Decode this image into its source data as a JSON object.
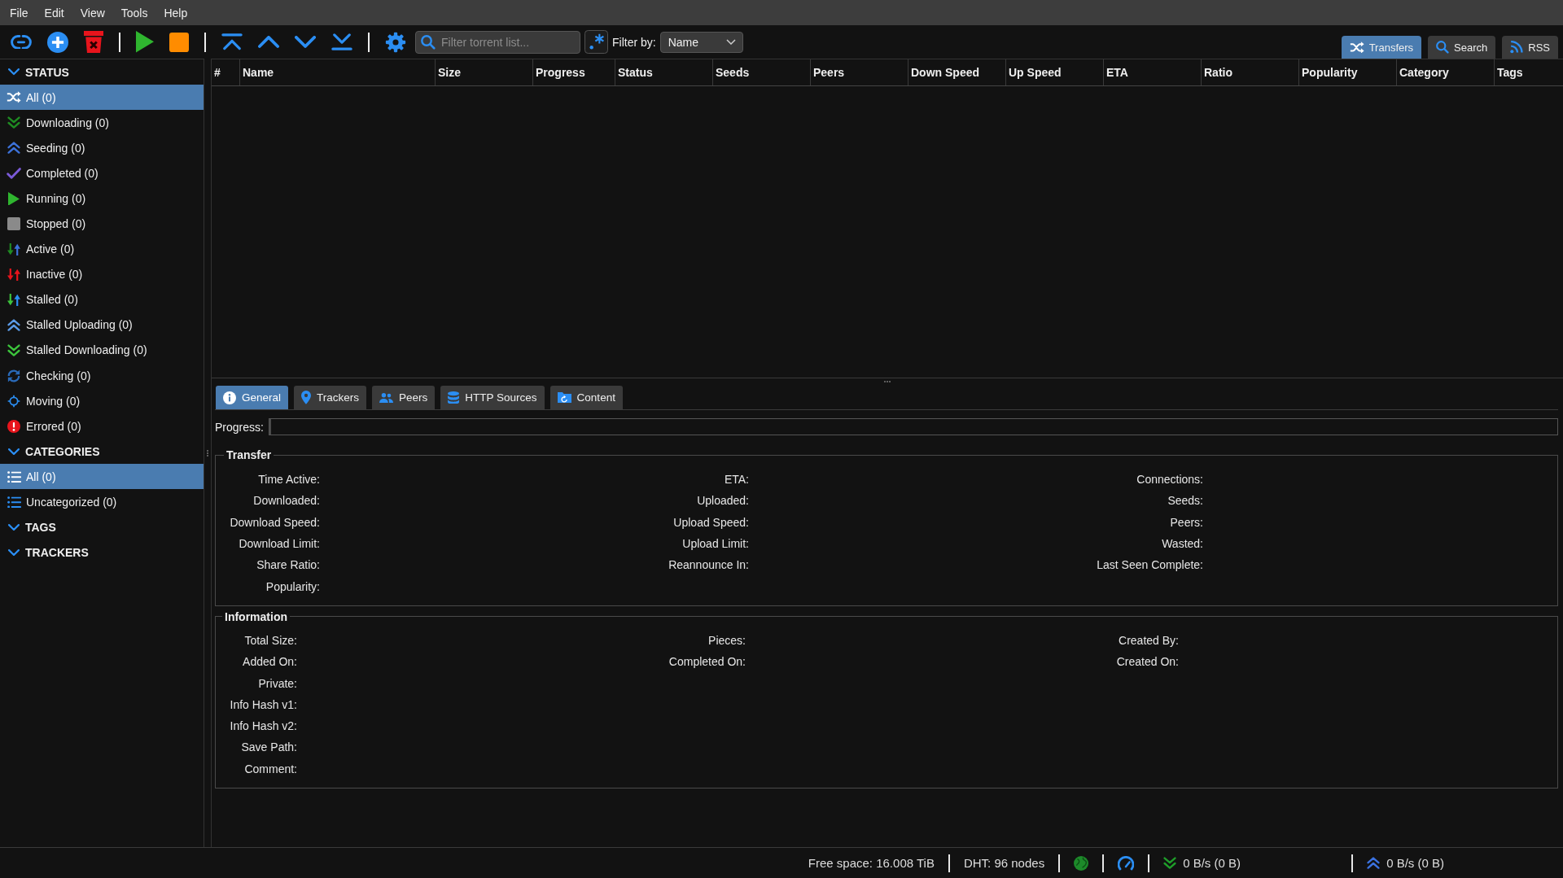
{
  "menu_bar": [
    "File",
    "Edit",
    "View",
    "Tools",
    "Help"
  ],
  "toolbar": {
    "filter": {
      "placeholder": "Filter torrent list..."
    },
    "filter_by": {
      "label": "Filter by:",
      "value": "Name"
    }
  },
  "view_tabs": [
    {
      "label": "Transfers",
      "selected": true
    },
    {
      "label": "Search",
      "selected": false
    },
    {
      "label": "RSS",
      "selected": false
    }
  ],
  "sidebar": {
    "sections": [
      {
        "title": "STATUS",
        "expanded": true,
        "items": [
          {
            "label": "All (0)",
            "selected": true
          },
          {
            "label": "Downloading (0)",
            "selected": false
          },
          {
            "label": "Seeding (0)",
            "selected": false
          },
          {
            "label": "Completed (0)",
            "selected": false
          },
          {
            "label": "Running (0)",
            "selected": false
          },
          {
            "label": "Stopped (0)",
            "selected": false
          },
          {
            "label": "Active (0)",
            "selected": false
          },
          {
            "label": "Inactive (0)",
            "selected": false
          },
          {
            "label": "Stalled (0)",
            "selected": false
          },
          {
            "label": "Stalled Uploading (0)",
            "selected": false
          },
          {
            "label": "Stalled Downloading (0)",
            "selected": false
          },
          {
            "label": "Checking (0)",
            "selected": false
          },
          {
            "label": "Moving (0)",
            "selected": false
          },
          {
            "label": "Errored (0)",
            "selected": false
          }
        ]
      },
      {
        "title": "CATEGORIES",
        "expanded": true,
        "items": [
          {
            "label": "All (0)",
            "selected": true
          },
          {
            "label": "Uncategorized (0)",
            "selected": false
          }
        ]
      },
      {
        "title": "TAGS",
        "expanded": true
      },
      {
        "title": "TRACKERS",
        "expanded": true
      }
    ]
  },
  "table": {
    "columns": [
      "#",
      "Name",
      "Size",
      "Progress",
      "Status",
      "Seeds",
      "Peers",
      "Down Speed",
      "Up Speed",
      "ETA",
      "Ratio",
      "Popularity",
      "Category",
      "Tags"
    ]
  },
  "details": {
    "tabs": [
      {
        "label": "General",
        "selected": true
      },
      {
        "label": "Trackers",
        "selected": false
      },
      {
        "label": "Peers",
        "selected": false
      },
      {
        "label": "HTTP Sources",
        "selected": false
      },
      {
        "label": "Content",
        "selected": false
      }
    ],
    "progress": {
      "label": "Progress:",
      "level": 0
    },
    "transfer": {
      "title": "Transfer",
      "rows": [
        [
          "Time Active:",
          "ETA:",
          "Connections:"
        ],
        [
          "Downloaded:",
          "Uploaded:",
          "Seeds:"
        ],
        [
          "Download Speed:",
          "Upload Speed:",
          "Peers:"
        ],
        [
          "Download Limit:",
          "Upload Limit:",
          "Wasted:"
        ],
        [
          "Share Ratio:",
          "Reannounce In:",
          "Last Seen Complete:"
        ],
        [
          "Popularity:"
        ]
      ]
    },
    "information": {
      "title": "Information",
      "rows": [
        [
          "Total Size:",
          "Pieces:",
          "Created By:"
        ],
        [
          "Added On:",
          "Completed On:",
          "Created On:"
        ],
        [
          "Private:"
        ],
        [
          "Info Hash v1:"
        ],
        [
          "Info Hash v2:"
        ],
        [
          "Save Path:"
        ],
        [
          "Comment:"
        ]
      ]
    }
  },
  "status_bar": {
    "free_space": "Free space: 16.008 TiB",
    "dht": "DHT: 96 nodes",
    "download_speed": "0 B/s (0 B)",
    "upload_speed": "0 B/s (0 B)"
  }
}
